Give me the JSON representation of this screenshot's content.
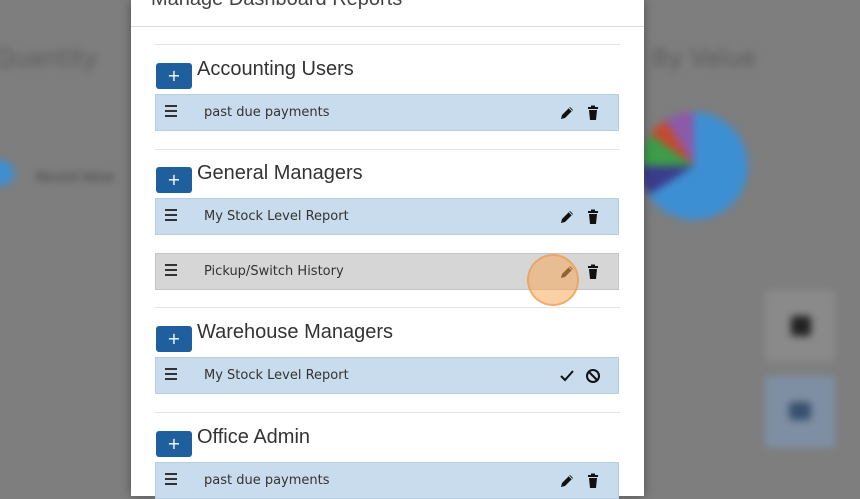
{
  "background": {
    "left_title": "Quantity",
    "right_title": "By Value",
    "left_legend": "Record Value"
  },
  "modal": {
    "title": "Manage Dashboard Reports",
    "groups": [
      {
        "name": "Accounting Users",
        "add_label": "+",
        "reports": [
          {
            "name": "past due payments",
            "actions": [
              "pencil-icon",
              "trash-icon"
            ],
            "state": "normal"
          }
        ]
      },
      {
        "name": "General Managers",
        "add_label": "+",
        "reports": [
          {
            "name": "My Stock Level Report",
            "actions": [
              "pencil-icon",
              "trash-icon"
            ],
            "state": "normal"
          },
          {
            "name": "Pickup/Switch History",
            "actions": [
              "pencil-icon",
              "trash-icon"
            ],
            "state": "hover"
          }
        ]
      },
      {
        "name": "Warehouse Managers",
        "add_label": "+",
        "reports": [
          {
            "name": "My Stock Level Report",
            "actions": [
              "check-icon",
              "cancel-icon"
            ],
            "state": "editing"
          }
        ]
      },
      {
        "name": "Office Admin",
        "add_label": "+",
        "reports": [
          {
            "name": "past due payments",
            "actions": [
              "pencil-icon",
              "trash-icon"
            ],
            "state": "normal"
          }
        ]
      }
    ]
  },
  "colors": {
    "row_bg": "#c9dced",
    "row_hover_bg": "#d6d6d6",
    "add_button": "#1f5f9e",
    "click_indicator": "#f5aa5a"
  }
}
